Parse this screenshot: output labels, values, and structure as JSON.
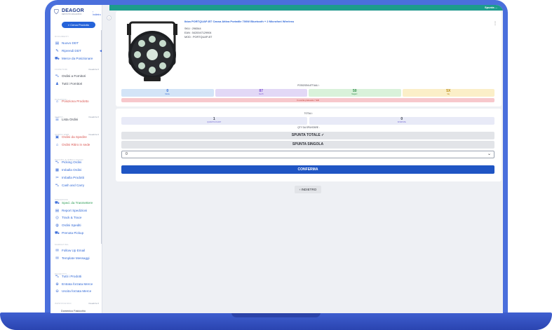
{
  "app": {
    "logo_text": "DEAGOR",
    "logo_sub": "DEPOSITO MAGAZZINO",
    "back_link": "Indietro",
    "topbar_user": "Spunta ...",
    "search_button": "Cerca Prodotto",
    "user_name": "Domenico Falcicchio"
  },
  "sidebar": {
    "sections": [
      {
        "title": "DOCUMENTI",
        "right": ""
      },
      {
        "title": "FORNITORI",
        "right": "Visualizza ▾"
      },
      {
        "title": "POSIZIONI",
        "right": ""
      },
      {
        "title": "ORDINI",
        "right": "Visualizza ▾"
      },
      {
        "title": "ORDINI WEB",
        "right": "Visualizza ▾"
      },
      {
        "title": "PICKING E IMBALLAGGIO",
        "right": ""
      },
      {
        "title": "SPEDIZIONI",
        "right": ""
      },
      {
        "title": "MARKETING",
        "right": ""
      },
      {
        "title": "PRODOTTI",
        "right": ""
      },
      {
        "title": "IMPOSTAZIONI",
        "right": "Visualizza ▾"
      }
    ],
    "items": [
      {
        "label": "Nuovo DDT",
        "icon": "document-icon",
        "glyph": "▤"
      },
      {
        "label": "Riprendi DDT",
        "icon": "edit-icon",
        "glyph": "✎"
      },
      {
        "label": "Merce da Posizionare",
        "icon": "truck-icon",
        "glyph": "⛟"
      },
      {
        "label": "Ordini a Fornitori",
        "icon": "cart-icon",
        "glyph": "⛍"
      },
      {
        "label": "Tutti i Fornitori",
        "icon": "user-icon",
        "glyph": "♟"
      },
      {
        "label": "Posiziona Prodotto",
        "icon": "location-icon",
        "glyph": "⌂"
      },
      {
        "label": "Lista Ordini",
        "icon": "list-icon",
        "glyph": "☰"
      },
      {
        "label": "Ordini da Spedire",
        "icon": "package-icon",
        "glyph": "▣"
      },
      {
        "label": "Ordini Ritiro in sede",
        "icon": "store-icon",
        "glyph": "⌂"
      },
      {
        "label": "Picking Ordini",
        "icon": "picking-icon",
        "glyph": "⛍"
      },
      {
        "label": "Imballa Ordini",
        "icon": "box-icon",
        "glyph": "▦"
      },
      {
        "label": "Imballa Prodotti",
        "icon": "tape-icon",
        "glyph": "✂"
      },
      {
        "label": "Cash and Carry",
        "icon": "cash-icon",
        "glyph": "⛍"
      },
      {
        "label": "Sped. da Trasmettere",
        "icon": "send-truck-icon",
        "glyph": "⛟"
      },
      {
        "label": "Report Spedizioni",
        "icon": "report-icon",
        "glyph": "▤"
      },
      {
        "label": "Track & Trace",
        "icon": "track-icon",
        "glyph": "◎"
      },
      {
        "label": "Ordini Spediti",
        "icon": "shipped-icon",
        "glyph": "◍"
      },
      {
        "label": "Prenota Pickup",
        "icon": "pickup-icon",
        "glyph": "⛟"
      },
      {
        "label": "Follow Up Email",
        "icon": "email-icon",
        "glyph": "✉"
      },
      {
        "label": "Template Messaggi",
        "icon": "template-icon",
        "glyph": "✉"
      },
      {
        "label": "Tutti i Prodotti",
        "icon": "products-icon",
        "glyph": "⛍"
      },
      {
        "label": "Entrata forzata Merce",
        "icon": "in-arrow-icon",
        "glyph": "⊕"
      },
      {
        "label": "Uscita forzata Merce",
        "icon": "out-arrow-icon",
        "glyph": "⊖"
      }
    ]
  },
  "product": {
    "title": "Ibiza PORTQUAP-BT Cassa Attiva Portatile 700W Bluetooth + 2 Microfoni Wireless",
    "sku": "SKU : 298344",
    "ean": "EAN : 5420047129904",
    "mod": "MOD : PORTQUAP-BT"
  },
  "positions": {
    "title": "POSIZIONI ATTUALI :",
    "cells": [
      {
        "value": "0",
        "label": "Monte",
        "bg": "#d3e4f7",
        "fg": "#2f67d6"
      },
      {
        "value": "87",
        "label": "Sud B",
        "bg": "#e2d8f6",
        "fg": "#7a4fd0"
      },
      {
        "value": "50",
        "label": "Magazz.",
        "bg": "#d9f2da",
        "fg": "#2f8d4a"
      },
      {
        "value": "5X",
        "label": "Sky",
        "bg": "#fbefc8",
        "fg": "#b8860b"
      }
    ],
    "alert": "In uscita prelevato 7 ED"
  },
  "totals": {
    "title": "TOTALI :",
    "cells": [
      {
        "value": "1",
        "label": "QUANTITÀ IN DDT"
      },
      {
        "value": "0",
        "label": "SPUNTATE"
      }
    ],
    "qty_title": "QTY DA SPUNTARE :"
  },
  "actions": {
    "spunta_totale": "SPUNTA TOTALE ✓",
    "spunta_singola": "SPUNTA SINGOLA",
    "select_value": "0",
    "confirm": "CONFERMA",
    "back": "‹ INDIETRO"
  }
}
